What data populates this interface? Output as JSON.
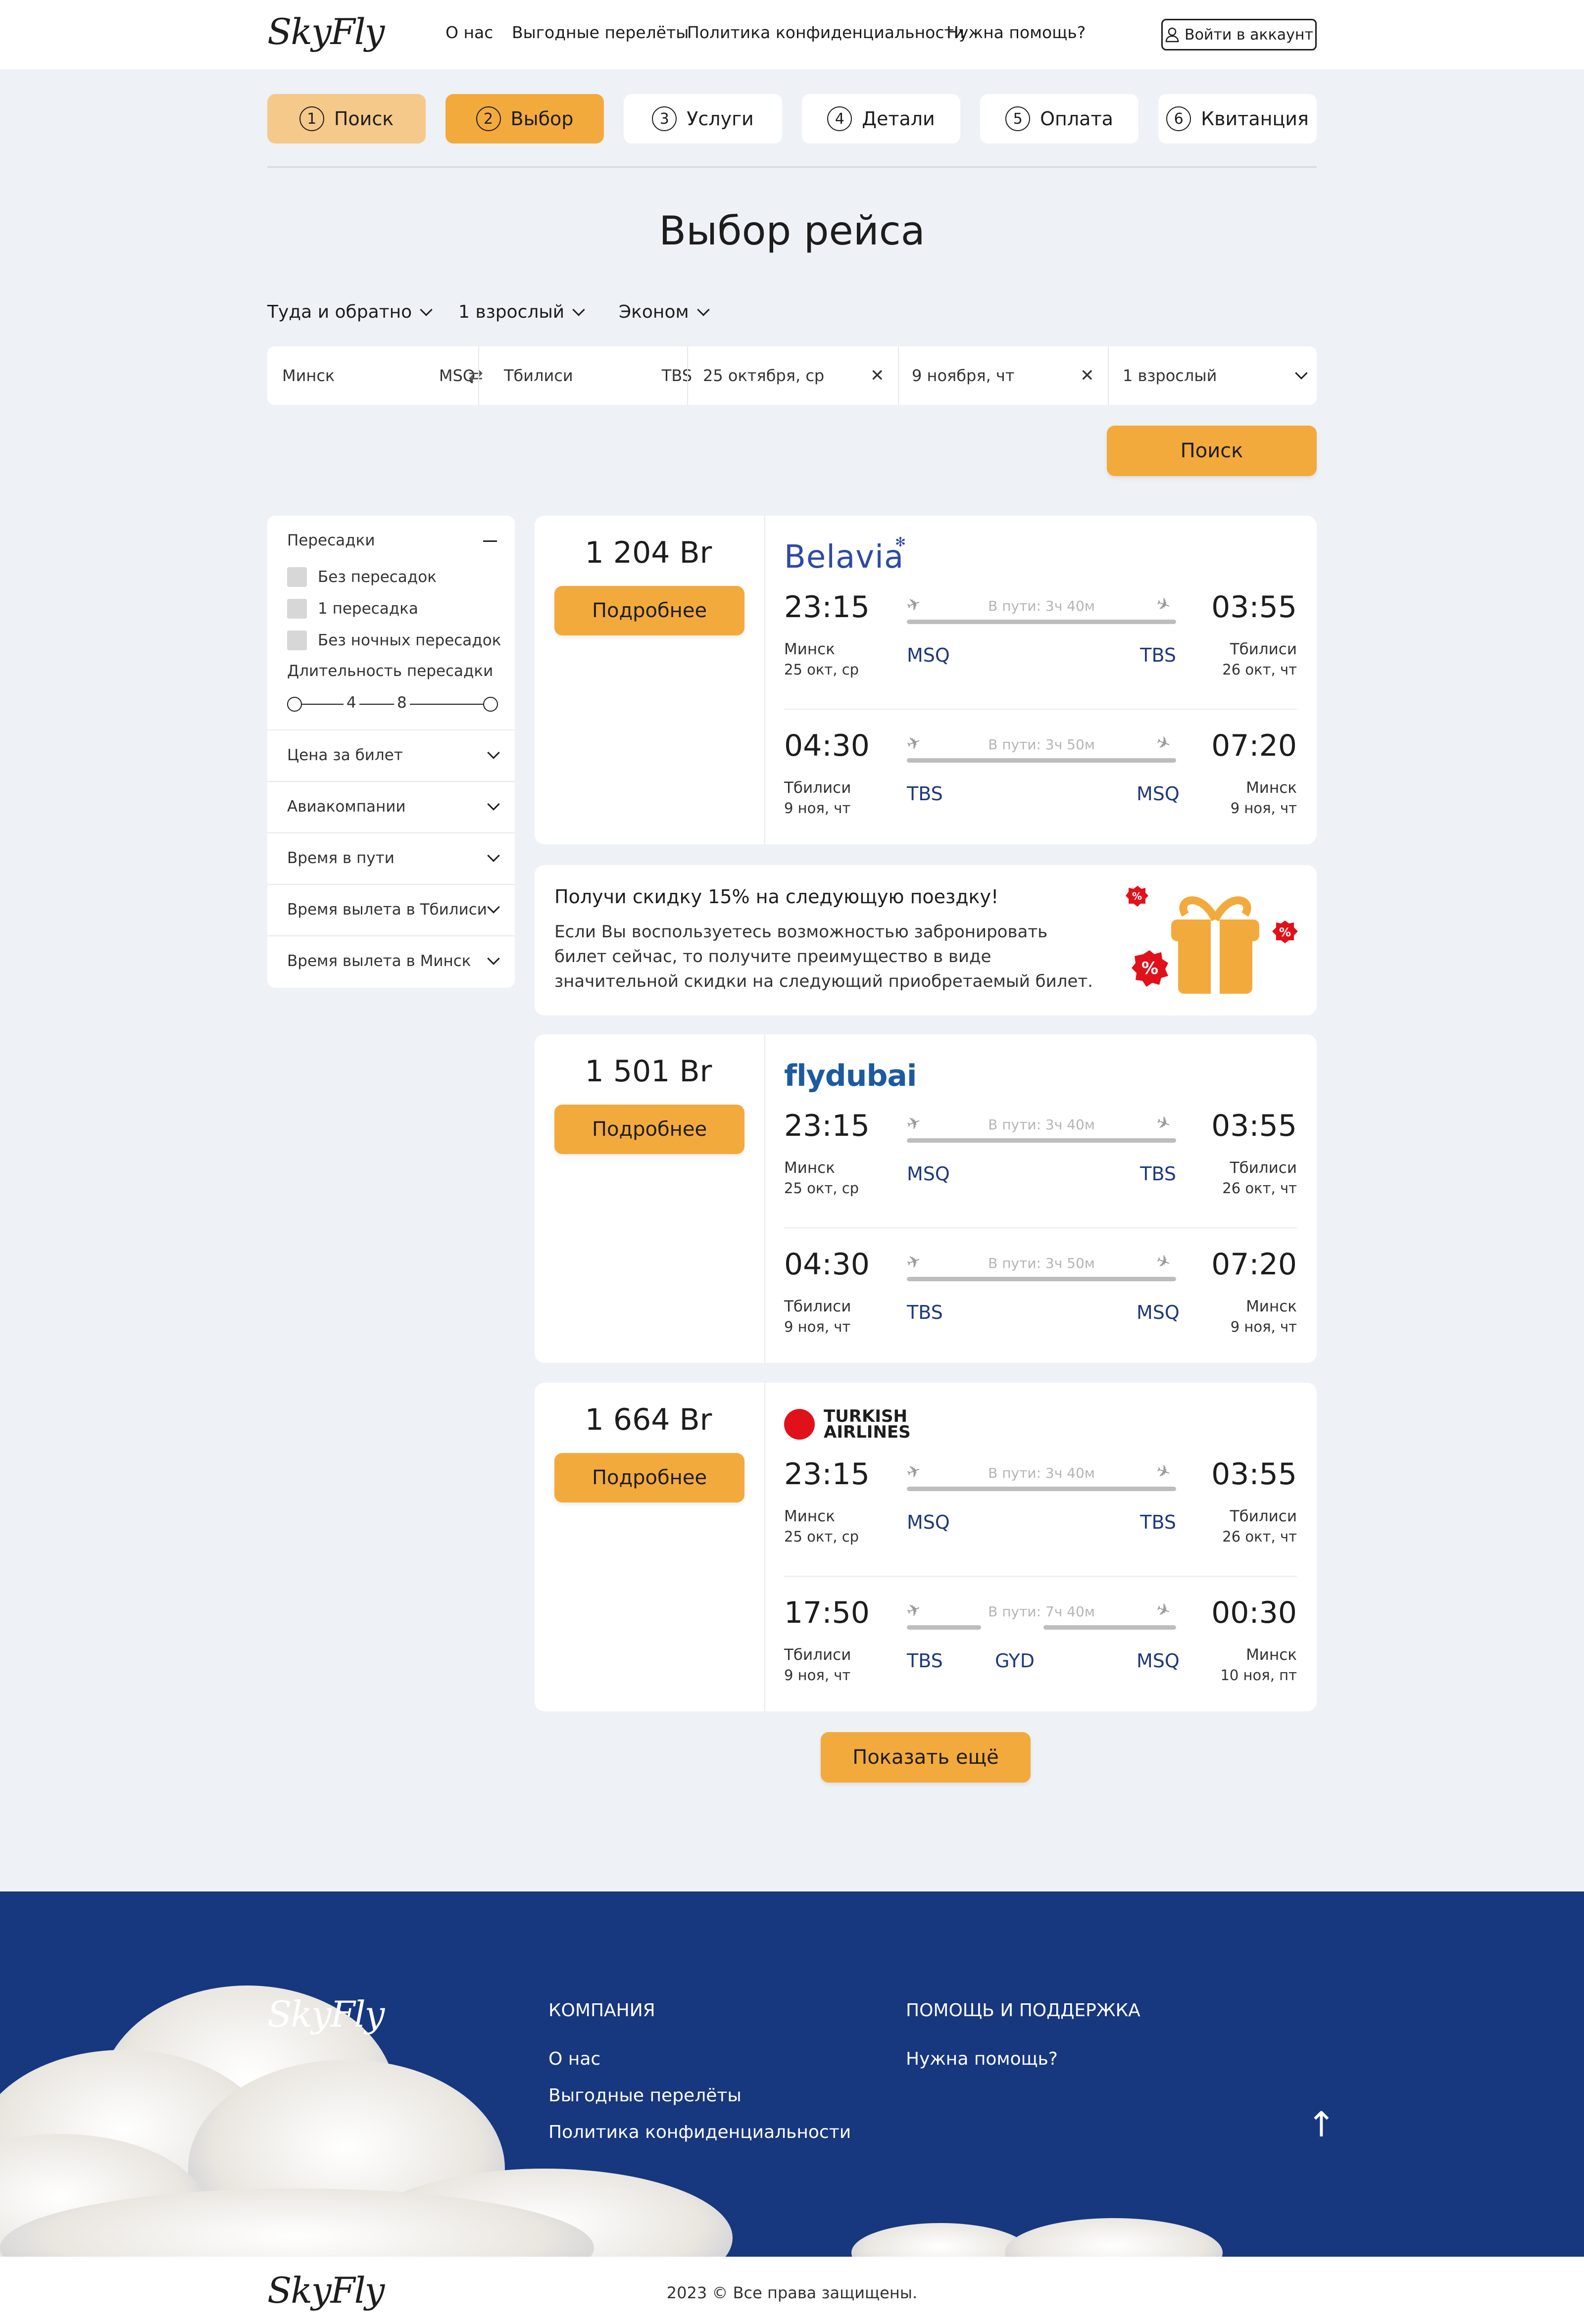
{
  "header": {
    "logo": "SkyFly",
    "nav": [
      "О нас",
      "Выгодные перелёты",
      "Политика конфиденциальности",
      "Нужна помощь?"
    ],
    "login": "Войти в аккаунт"
  },
  "steps": [
    {
      "num": "1",
      "label": "Поиск",
      "state": "done"
    },
    {
      "num": "2",
      "label": "Выбор",
      "state": "active"
    },
    {
      "num": "3",
      "label": "Услуги",
      "state": "todo"
    },
    {
      "num": "4",
      "label": "Детали",
      "state": "todo"
    },
    {
      "num": "5",
      "label": "Оплата",
      "state": "todo"
    },
    {
      "num": "6",
      "label": "Квитанция",
      "state": "todo"
    }
  ],
  "title": "Выбор рейса",
  "options": {
    "trip": "Туда и обратно",
    "passengers": "1 взрослый",
    "class": "Эконом"
  },
  "search": {
    "from_city": "Минск",
    "from_code": "MSQ",
    "to_city": "Тбилиси",
    "to_code": "TBS",
    "depart": "25 октября, ср",
    "return": "9 ноября, чт",
    "passengers": "1 взрослый",
    "button": "Поиск"
  },
  "filters": {
    "stops_title": "Пересадки",
    "stops": [
      "Без пересадок",
      "1 пересадка",
      "Без ночных пересадок"
    ],
    "duration_title": "Длительность пересадки",
    "duration_ticks": [
      "4",
      "8"
    ],
    "sections": [
      "Цена за билет",
      "Авиакомпании",
      "Время в пути",
      "Время вылета в Тбилиси",
      "Время вылета в Минск"
    ]
  },
  "details_label": "Подробнее",
  "flights": [
    {
      "price": "1 204 Br",
      "airline": "Belavia",
      "legs": [
        {
          "dep_time": "23:15",
          "dep_city": "Минск",
          "dep_date": "25 окт, ср",
          "dep_code": "MSQ",
          "arr_time": "03:55",
          "arr_city": "Тбилиси",
          "arr_date": "26 окт, чт",
          "arr_code": "TBS",
          "duration": "В пути: 3ч 40м",
          "via": ""
        },
        {
          "dep_time": "04:30",
          "dep_city": "Тбилиси",
          "dep_date": "9 ноя, чт",
          "dep_code": "TBS",
          "arr_time": "07:20",
          "arr_city": "Минск",
          "arr_date": "9 ноя, чт",
          "arr_code": "MSQ",
          "duration": "В пути: 3ч 50м",
          "via": ""
        }
      ]
    },
    {
      "price": "1 501 Br",
      "airline": "flydubai",
      "legs": [
        {
          "dep_time": "23:15",
          "dep_city": "Минск",
          "dep_date": "25 окт, ср",
          "dep_code": "MSQ",
          "arr_time": "03:55",
          "arr_city": "Тбилиси",
          "arr_date": "26 окт, чт",
          "arr_code": "TBS",
          "duration": "В пути: 3ч 40м",
          "via": ""
        },
        {
          "dep_time": "04:30",
          "dep_city": "Тбилиси",
          "dep_date": "9 ноя, чт",
          "dep_code": "TBS",
          "arr_time": "07:20",
          "arr_city": "Минск",
          "arr_date": "9 ноя, чт",
          "arr_code": "MSQ",
          "duration": "В пути: 3ч 50м",
          "via": ""
        }
      ]
    },
    {
      "price": "1 664 Br",
      "airline": "TURKISH AIRLINES",
      "legs": [
        {
          "dep_time": "23:15",
          "dep_city": "Минск",
          "dep_date": "25 окт, ср",
          "dep_code": "MSQ",
          "arr_time": "03:55",
          "arr_city": "Тбилиси",
          "arr_date": "26 окт, чт",
          "arr_code": "TBS",
          "duration": "В пути: 3ч 40м",
          "via": ""
        },
        {
          "dep_time": "17:50",
          "dep_city": "Тбилиси",
          "dep_date": "9 ноя, чт",
          "dep_code": "TBS",
          "arr_time": "00:30",
          "arr_city": "Минск",
          "arr_date": "10 ноя, пт",
          "arr_code": "MSQ",
          "duration": "В пути: 7ч 40м",
          "via": "GYD"
        }
      ]
    }
  ],
  "promo": {
    "title": "Получи скидку 15% на следующую поездку!",
    "text": "Если Вы воспользуетесь возможностью забронировать билет сейчас, то получите преимущество в виде значительной скидки на следующий приобретаемый билет.",
    "badge": "%"
  },
  "show_more": "Показать ещё",
  "footer": {
    "logo": "SkyFly",
    "company_title": "КОМПАНИЯ",
    "company_links": [
      "О нас",
      "Выгодные перелёты",
      "Политика конфиденциальности"
    ],
    "help_title": "ПОМОЩЬ И ПОДДЕРЖКА",
    "help_links": [
      "Нужна помощь?"
    ],
    "up_arrow": "↑",
    "copyright": "2023 © Все права защищены."
  },
  "colors": {
    "accent": "#f3aa3c",
    "accent_light": "#f5c98a",
    "footer_bg": "#17377f",
    "code": "#1e3a7b"
  }
}
